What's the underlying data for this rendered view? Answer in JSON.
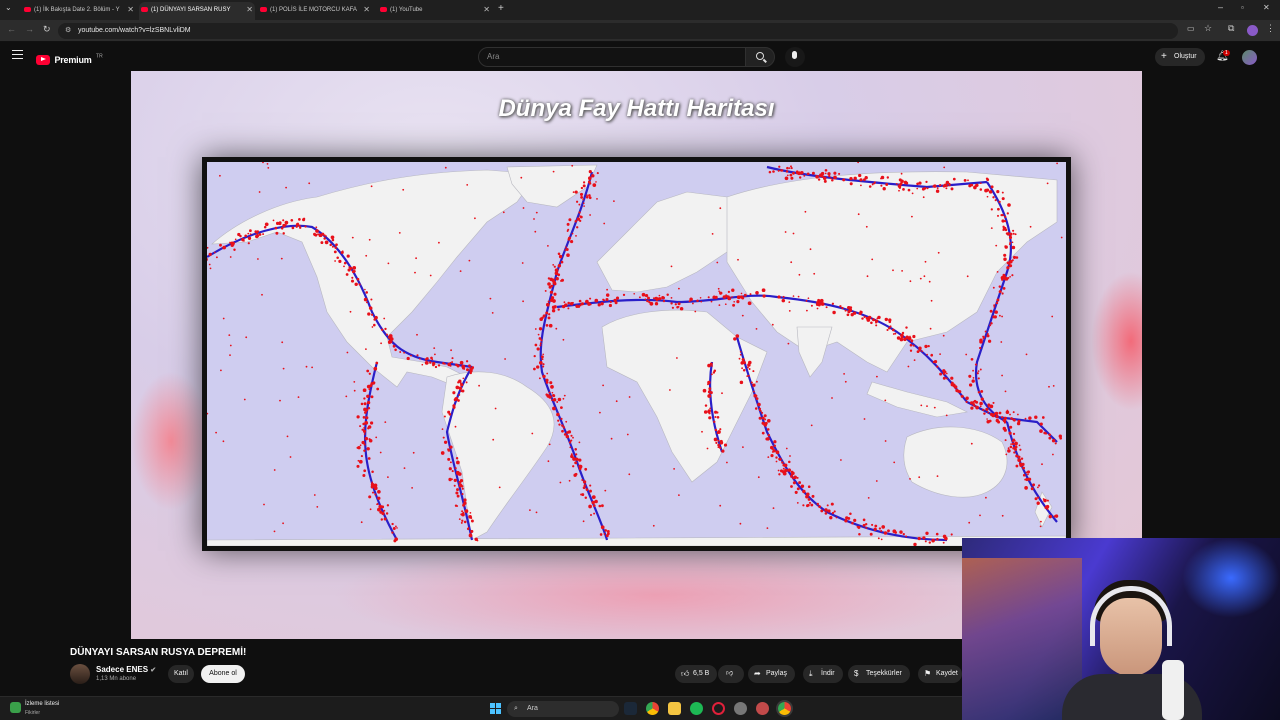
{
  "browser": {
    "tabs": [
      {
        "title": "(1) İlk Bakışta Date 2. Bölüm - Y",
        "active": false
      },
      {
        "title": "(1) DÜNYAYI SARSAN RUSY",
        "active": true
      },
      {
        "title": "(1) POLİS İLE MOTORCU KAFA",
        "active": false
      },
      {
        "title": "(1) YouTube",
        "active": false
      }
    ],
    "url": "youtube.com/watch?v=lzSBNLvliDM"
  },
  "youtube": {
    "logo_text": "Premium",
    "logo_badge": "TR",
    "search_placeholder": "Ara",
    "create_label": "Oluştur",
    "notifications_count": "1"
  },
  "video": {
    "map_title": "Dünya Fay Hattı Haritası",
    "title": "DÜNYAYI SARSAN RUSYA DEPREMİ!",
    "channel": "Sadece ENES",
    "subscribers": "1,13 Mn abone",
    "join_label": "Katıl",
    "subscribe_label": "Abone ol",
    "likes": "6,5 B",
    "share_label": "Paylaş",
    "download_label": "İndir",
    "thanks_label": "Teşekkürler",
    "save_label": "Kaydet"
  },
  "taskbar": {
    "widget_title": "İzleme listesi",
    "widget_sub": "Fikirler",
    "search_placeholder": "Ara"
  },
  "colors": {
    "yt_red": "#ff0033",
    "ocean": "#cfcdf0",
    "land": "#f2f2f2",
    "plate_boundary": "#2a1fc8",
    "quake_dot": "#e8101a"
  }
}
